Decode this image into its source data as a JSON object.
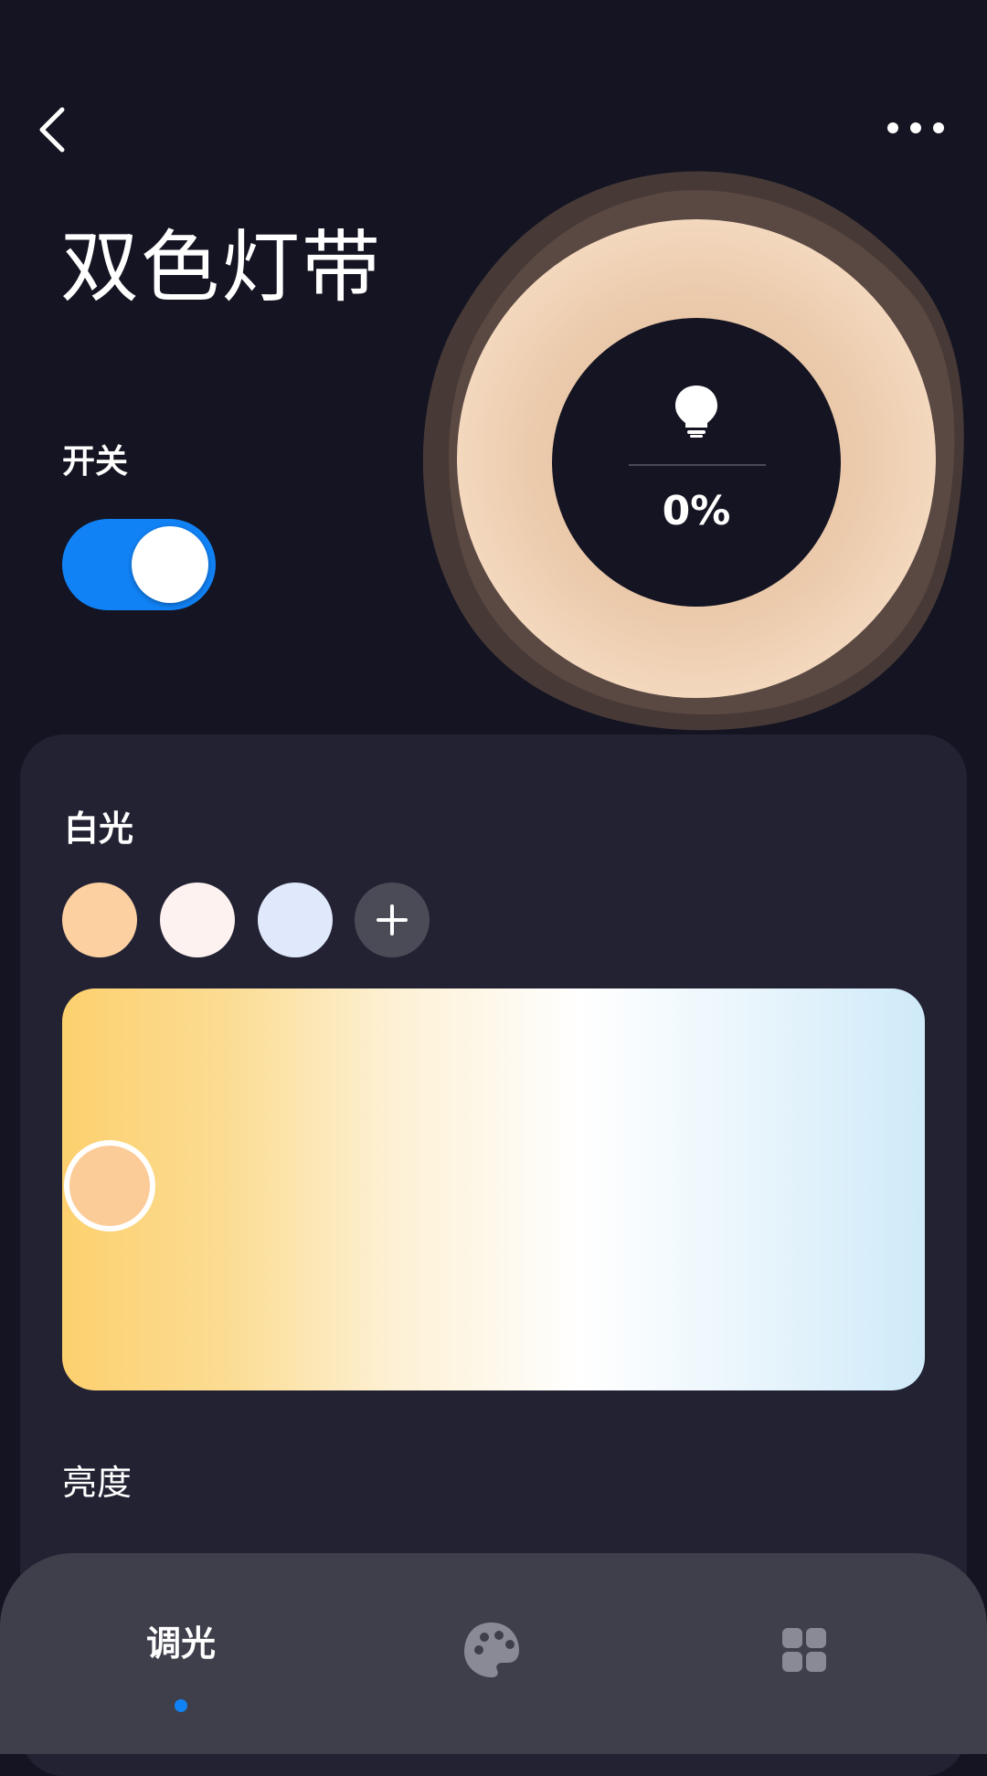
{
  "header": {
    "back_icon": "chevron-left-icon",
    "more_icon": "more-horizontal-icon"
  },
  "device": {
    "title": "双色灯带"
  },
  "power": {
    "label": "开关",
    "on": true
  },
  "lamp": {
    "brightness_text": "0%",
    "icon": "lightbulb-icon",
    "glow_color": "#f2d0b0"
  },
  "white_light": {
    "label": "白光",
    "presets": [
      {
        "name": "warm",
        "color": "#fcd0a1"
      },
      {
        "name": "neutral",
        "color": "#fdf2f0"
      },
      {
        "name": "cool",
        "color": "#e0e8fb"
      }
    ],
    "add_icon": "plus-icon",
    "temperature_position": 0.05
  },
  "brightness": {
    "label": "亮度"
  },
  "nav": {
    "items": [
      {
        "label": "调光",
        "active": true
      },
      {
        "icon": "palette-icon",
        "active": false
      },
      {
        "icon": "grid-icon",
        "active": false
      }
    ],
    "accent": "#1182f5"
  }
}
